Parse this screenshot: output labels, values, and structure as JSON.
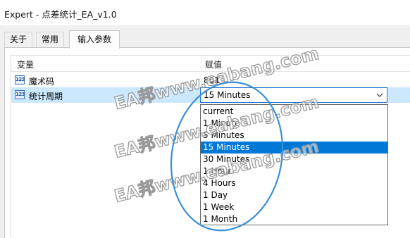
{
  "window": {
    "title": "Expert - 点差统计_EA_v1.0"
  },
  "tabs": [
    {
      "label": "关于",
      "active": false
    },
    {
      "label": "常用",
      "active": false
    },
    {
      "label": "输入参数",
      "active": true
    }
  ],
  "table": {
    "columns": [
      "变量",
      "赋值"
    ],
    "rows": [
      {
        "icon": "parameter-icon",
        "icon_text": "123",
        "name": "魔术码",
        "value": "801",
        "selected": false
      },
      {
        "icon": "parameter-icon",
        "icon_text": "123",
        "name": "统计周期",
        "value": "15 Minutes",
        "selected": true
      }
    ]
  },
  "dropdown": {
    "selected": "15 Minutes",
    "options": [
      "current",
      "1 Minute",
      "5 Minutes",
      "15 Minutes",
      "30 Minutes",
      "1 Hour",
      "4 Hours",
      "1 Day",
      "1 Week",
      "1 Month"
    ]
  },
  "watermark": {
    "text": "EA邦www.eabang.com"
  },
  "colors": {
    "selection": "#0078d7",
    "row_highlight": "#cce8ff",
    "annotation": "#3a8fd8"
  }
}
